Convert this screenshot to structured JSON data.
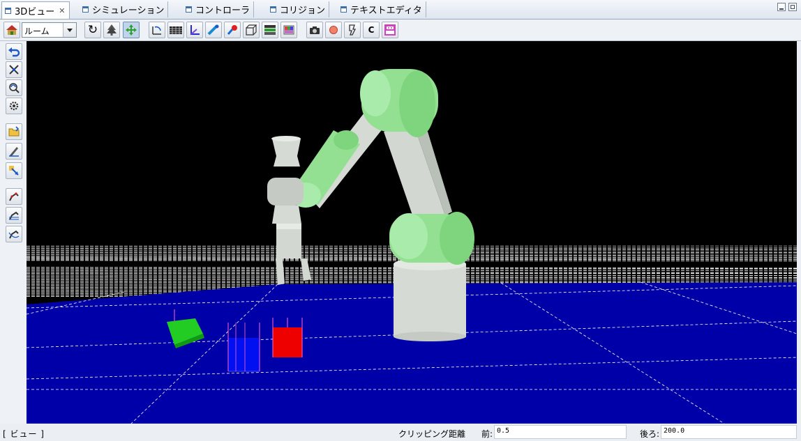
{
  "tabs": [
    {
      "label": "3Dビュー",
      "active": true,
      "closable": true
    },
    {
      "label": "シミュレーション"
    },
    {
      "label": "コントローラ"
    },
    {
      "label": "コリジョン"
    },
    {
      "label": "テキストエディタ"
    }
  ],
  "toolbar": {
    "view_mode_select": {
      "value": "ルーム"
    },
    "buttons": [
      "room-icon",
      "rotate-icon",
      "tree-icon",
      "move-arrows-icon",
      "axis-rotate-icon",
      "grid-floor-icon",
      "axes-icon",
      "ruler-icon",
      "marker-icon",
      "wire-cube-icon",
      "render-settings-icon",
      "color-palette-icon",
      "camera-icon",
      "record-icon",
      "jog-icon",
      "c-icon",
      "robot-pink-icon"
    ],
    "c_label": "C"
  },
  "left_tools": [
    "undo-arrow-icon",
    "pan-cross-icon",
    "orbit-icon",
    "gear-zoom-icon",
    "open-folder-icon",
    "pen-icon",
    "pick-icon",
    "robot-teach-icon",
    "robot-jog-icon",
    "robot-path-icon"
  ],
  "viewport": {
    "colors": {
      "sky": "#000000",
      "floor": "#0000a8",
      "grid_white": "#ffffff",
      "robot_body": "#d5dbd4",
      "robot_joint": "#94e092",
      "green_block": "#22cc22",
      "blue_block": "#0010f0",
      "red_block": "#ee0000",
      "marker_pink": "#ff66cc"
    }
  },
  "status": {
    "mode": "[  ビュー  ]",
    "clipping_label": "クリッピング距離",
    "near_label": "前:",
    "near_value": "0.5",
    "far_label": "後ろ:",
    "far_value": "200.0"
  }
}
